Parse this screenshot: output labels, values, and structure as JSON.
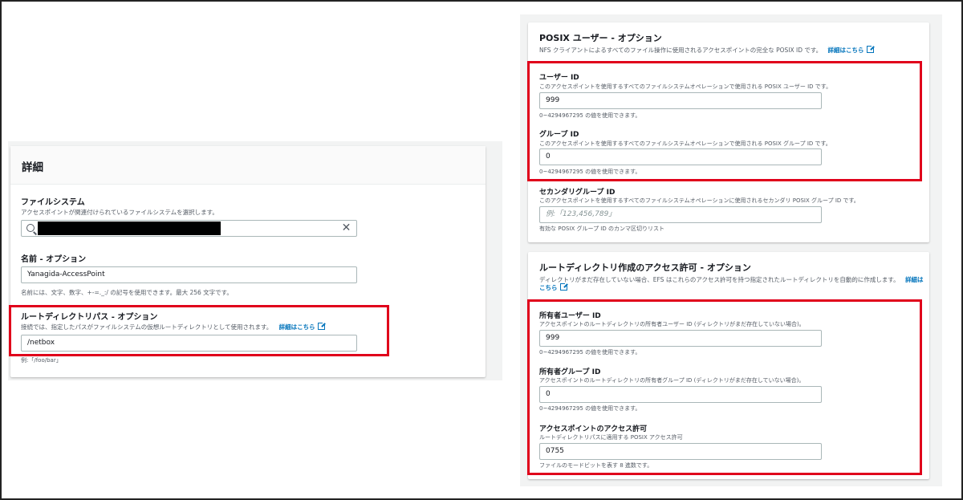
{
  "left": {
    "card_title": "詳細",
    "filesystem": {
      "label": "ファイルシステム",
      "desc": "アクセスポイントが関連付けられているファイルシステムを選択します。"
    },
    "name": {
      "label": "名前 - オプション",
      "value": "Yanagida-AccessPoint",
      "hint": "名前には、文字、数字、+-=._:/ の記号を使用できます。最大 256 文字です。"
    },
    "root_path": {
      "label": "ルートディレクトリパス - オプション",
      "desc": "接続では、指定したパスがファイルシステムの仮想ルートディレクトリとして使用されます。",
      "link": "詳細はこちら",
      "value": "/netbox",
      "hint": "例:「/foo/bar」"
    }
  },
  "posix": {
    "title": "POSIX ユーザー - オプション",
    "desc": "NFS クライアントによるすべてのファイル操作に使用されるアクセスポイントの完全な POSIX ID です。",
    "link": "詳細はこちら",
    "user_id": {
      "label": "ユーザー ID",
      "desc": "このアクセスポイントを使用するすべてのファイルシステムオペレーションで使用される POSIX ユーザー ID です。",
      "value": "999",
      "hint": "0~4294967295 の値を使用できます。"
    },
    "group_id": {
      "label": "グループ ID",
      "desc": "このアクセスポイントを使用するすべてのファイルシステムオペレーションで使用される POSIX グループ ID です。",
      "value": "0",
      "hint": "0~4294967295 の値を使用できます。"
    },
    "secondary": {
      "label": "セカンダリグループ ID",
      "desc": "このアクセスポイントを使用するすべてのファイルシステムオペレーションに使用されるセカンダリ POSIX グループ ID です。",
      "placeholder": "例:「123,456,789」",
      "hint": "有効な POSIX グループ ID のカンマ区切りリスト"
    }
  },
  "rootperm": {
    "title": "ルートディレクトリ作成のアクセス許可 - オプション",
    "desc": "ディレクトリがまだ存在していない場合、EFS はこれらのアクセス許可を持つ指定されたルートディレクトリを自動的に作成します。",
    "link_a": "詳細は",
    "link_b": "こちら",
    "owner_uid": {
      "label": "所有者ユーザー ID",
      "desc": "アクセスポイントのルートディレクトリの所有者ユーザー ID (ディレクトリがまだ存在していない場合)。",
      "value": "999",
      "hint": "0~4294967295 の値を使用できます。"
    },
    "owner_gid": {
      "label": "所有者グループ ID",
      "desc": "アクセスポイントのルートディレクトリの所有者グループ ID (ディレクトリがまだ存在していない場合)。",
      "value": "0",
      "hint": "0~4294967295 の値を使用できます。"
    },
    "perms": {
      "label": "アクセスポイントのアクセス許可",
      "desc": "ルートディレクトリパスに適用する POSIX アクセス許可",
      "value": "0755",
      "hint": "ファイルのモードビットを表す 8 進数です。"
    }
  },
  "colors": {
    "highlight": "#e0001b",
    "link": "#0073bb"
  }
}
